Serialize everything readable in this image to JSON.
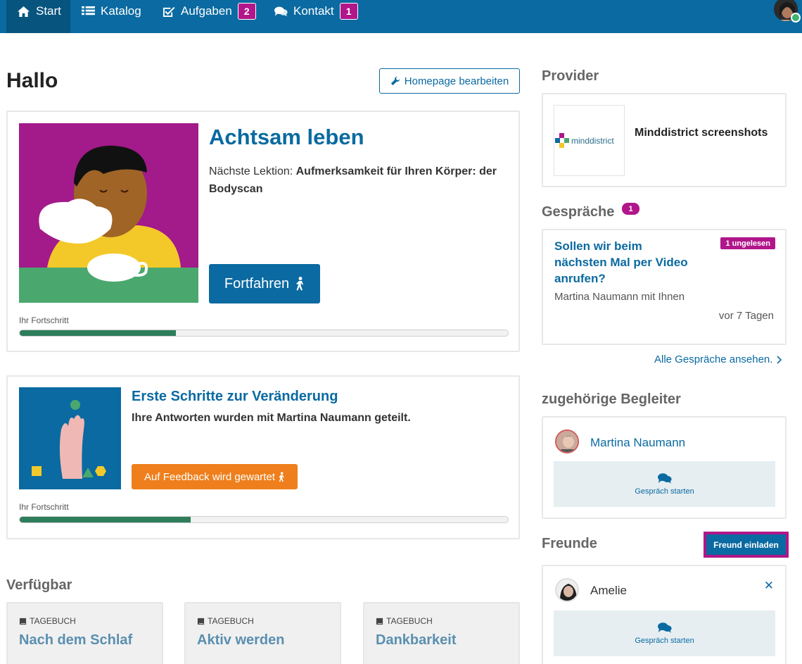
{
  "nav": {
    "items": [
      {
        "label": "Start",
        "icon": "home-icon",
        "badge": ""
      },
      {
        "label": "Katalog",
        "icon": "list-icon",
        "badge": ""
      },
      {
        "label": "Aufgaben",
        "icon": "checkbox-icon",
        "badge": "2"
      },
      {
        "label": "Kontakt",
        "icon": "chat-icon",
        "badge": "1"
      }
    ]
  },
  "main": {
    "title": "Hallo",
    "edit_button": "Homepage bearbeiten",
    "courses": [
      {
        "title": "Achtsam leben",
        "next_label": "Nächste Lektion: ",
        "next_value": "Aufmerksamkeit für Ihren Körper: der Bodyscan",
        "button": "Fortfahren",
        "progress_label": "Ihr Fortschritt",
        "progress": 0.32
      },
      {
        "title": "Erste Schritte zur Veränderung",
        "subtitle": "Ihre Antworten wurden mit Martina Naumann geteilt.",
        "button": "Auf Feedback wird gewartet",
        "progress_label": "Ihr Fortschritt",
        "progress": 0.35
      }
    ],
    "available": {
      "heading": "Verfügbar",
      "items": [
        {
          "kind": "TAGEBUCH",
          "title": "Nach dem Schlaf"
        },
        {
          "kind": "TAGEBUCH",
          "title": "Aktiv werden"
        },
        {
          "kind": "TAGEBUCH",
          "title": "Dankbarkeit"
        }
      ]
    }
  },
  "sidebar": {
    "provider": {
      "heading": "Provider",
      "logo_text": "minddistrict",
      "name": "Minddistrict screenshots"
    },
    "conversations": {
      "heading": "Gespräche",
      "badge": "1",
      "item": {
        "title": "Sollen wir beim nächsten Mal per Video anrufen?",
        "unread": "1 ungelesen",
        "participants": "Martina Naumann mit Ihnen",
        "time": "vor 7 Tagen"
      },
      "all_link": "Alle Gespräche ansehen."
    },
    "companions": {
      "heading": "zugehörige Begleiter",
      "name": "Martina Naumann",
      "chat_label": "Gespräch starten"
    },
    "friends": {
      "heading": "Freunde",
      "invite_button": "Freund einladen",
      "name": "Amelie",
      "chat_label": "Gespräch starten"
    }
  },
  "colors": {
    "primary": "#0a6aa1",
    "accent": "#b1168a",
    "warning": "#ee7f1c",
    "progress": "#2e7d5b"
  }
}
